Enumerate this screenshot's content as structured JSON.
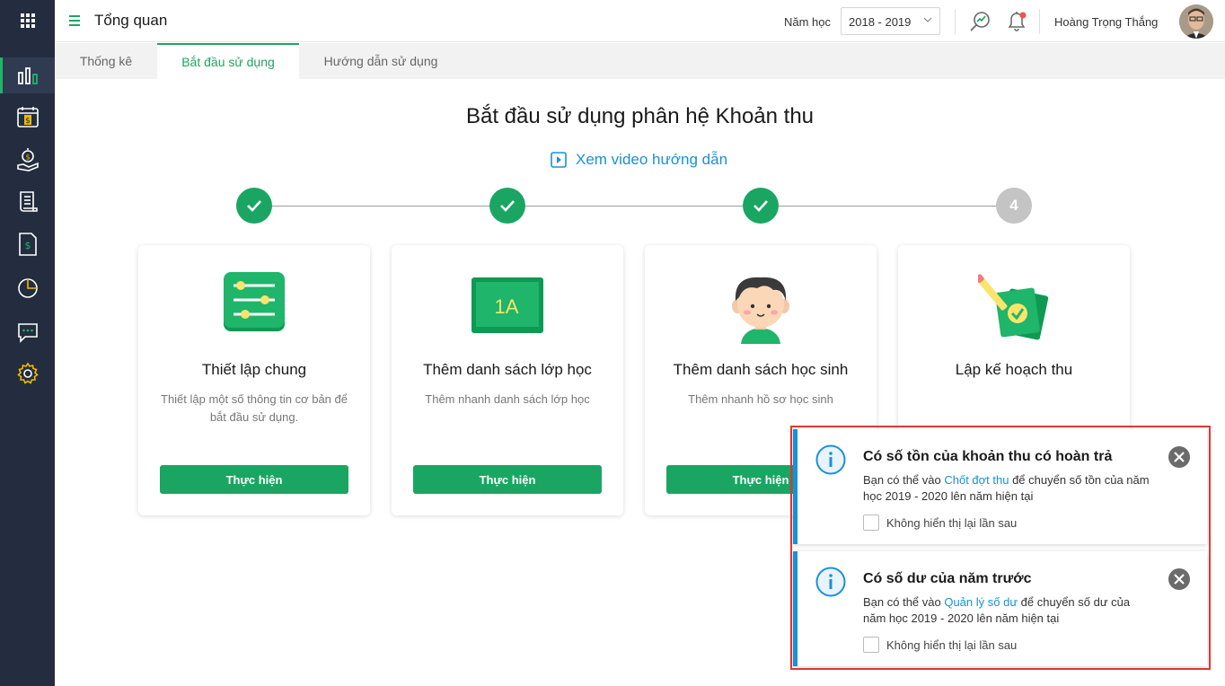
{
  "topbar": {
    "title": "Tổng quan",
    "year_label": "Năm học",
    "year_value": "2018 - 2019",
    "user_name": "Hoàng Trọng  Thắng"
  },
  "tabs": [
    {
      "label": "Thống kê",
      "active": false
    },
    {
      "label": "Bắt đầu sử dụng",
      "active": true
    },
    {
      "label": "Hướng dẫn sử dụng",
      "active": false
    }
  ],
  "main": {
    "title": "Bắt đầu sử dụng phân hệ Khoản thu",
    "video_link": "Xem video hướng dẫn"
  },
  "steps": [
    {
      "state": "done"
    },
    {
      "state": "done"
    },
    {
      "state": "done"
    },
    {
      "state": "todo",
      "number": "4"
    }
  ],
  "cards": [
    {
      "title": "Thiết lập chung",
      "desc": "Thiết lập một số thông tin cơ bản để bắt đầu sử dụng.",
      "button": "Thực hiện"
    },
    {
      "title": "Thêm danh sách lớp học",
      "desc": "Thêm nhanh danh sách lớp học",
      "button": "Thực hiện",
      "illus_text": "1A"
    },
    {
      "title": "Thêm danh sách học sinh",
      "desc": "Thêm nhanh hồ sơ học sinh",
      "button": "Thực hiện"
    },
    {
      "title": "Lập kế hoạch thu",
      "desc": "",
      "button": ""
    }
  ],
  "notifications": [
    {
      "title": "Có số tồn của khoản thu có hoàn trả",
      "body_prefix": "Bạn có thể vào ",
      "link": "Chốt đợt thu",
      "body_suffix": " để chuyển số tồn của năm học 2019 - 2020 lên năm hiện tại",
      "checkbox_label": "Không hiển thị lại lần sau"
    },
    {
      "title": "Có số dư của năm trước",
      "body_prefix": "Bạn có thể vào ",
      "link": "Quản lý số dư",
      "body_suffix": " để chuyển số dư của năm học 2019 - 2020 lên năm hiện tại",
      "checkbox_label": "Không hiển thị lại lần sau"
    }
  ],
  "colors": {
    "sidebar": "#232d3f",
    "accent_green": "#1aa662",
    "link_blue": "#1a90d8",
    "highlight_red": "#e53935"
  },
  "sidebar_icons": [
    "apps-grid-icon",
    "bar-chart-icon",
    "calendar-dollar-icon",
    "money-hand-icon",
    "scroll-icon",
    "dollar-document-icon",
    "pie-chart-icon",
    "chat-icon",
    "settings-gear-icon"
  ]
}
